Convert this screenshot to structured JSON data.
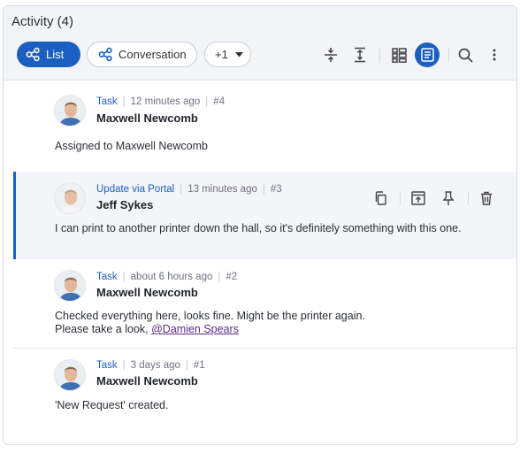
{
  "panel": {
    "title": "Activity (4)"
  },
  "toolbar": {
    "list_label": "List",
    "conversation_label": "Conversation",
    "more_label": "+1"
  },
  "colors": {
    "accent": "#1b5fc1",
    "mention": "#5b2a86"
  },
  "entries": [
    {
      "type": "Task",
      "time": "12 minutes ago",
      "number": "#4",
      "author": "Maxwell Newcomb",
      "body_lines": [
        "Assigned to Maxwell Newcomb"
      ]
    },
    {
      "type": "Update via Portal",
      "time": "13 minutes ago",
      "number": "#3",
      "author": "Jeff Sykes",
      "body_lines": [
        "I can print to another printer down the hall, so it's definitely something with this one."
      ],
      "actions": [
        "copy-icon",
        "move-up-icon",
        "pin-icon",
        "trash-icon"
      ]
    },
    {
      "type": "Task",
      "time": "about 6 hours ago",
      "number": "#2",
      "author": "Maxwell Newcomb",
      "body_lines": [
        "Checked everything here, looks fine. Might be the printer again.",
        "Please take a look, "
      ],
      "mention": "@Damien Spears"
    },
    {
      "type": "Task",
      "time": "3 days ago",
      "number": "#1",
      "author": "Maxwell Newcomb",
      "body_lines": [
        "'New Request' created."
      ]
    }
  ]
}
